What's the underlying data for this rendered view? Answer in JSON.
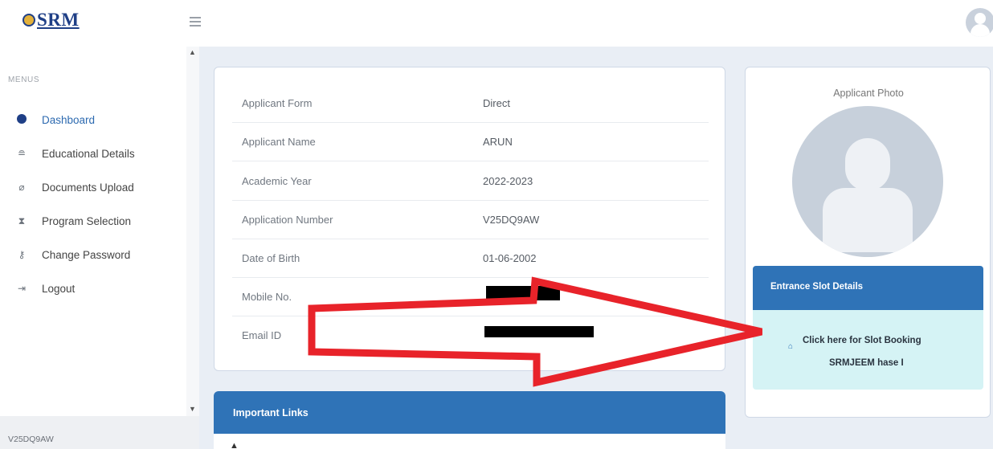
{
  "header": {
    "logo_text": "SRM",
    "menu_icon": "hamburger-icon",
    "avatar_icon": "user-avatar-icon"
  },
  "sidebar": {
    "section_label": "MENUS",
    "items": [
      {
        "label": "Dashboard",
        "icon": "dashboard-icon",
        "active": true
      },
      {
        "label": "Educational Details",
        "icon": "education-icon"
      },
      {
        "label": "Documents Upload",
        "icon": "paperclip-icon"
      },
      {
        "label": "Program Selection",
        "icon": "hourglass-icon"
      },
      {
        "label": "Change Password",
        "icon": "key-icon"
      },
      {
        "label": "Logout",
        "icon": "logout-icon"
      }
    ],
    "footer_text": "V25DQ9AW"
  },
  "applicant": {
    "rows": [
      {
        "label": "Applicant Form",
        "value": "Direct"
      },
      {
        "label": "Applicant Name",
        "value": "ARUN"
      },
      {
        "label": "Academic Year",
        "value": "2022-2023"
      },
      {
        "label": "Application Number",
        "value": "V25DQ9AW"
      },
      {
        "label": "Date of Birth",
        "value": "01-06-2002"
      },
      {
        "label": "Mobile No.",
        "value": ""
      },
      {
        "label": "Email ID",
        "value": ""
      }
    ]
  },
  "important_links": {
    "title": "Important Links"
  },
  "photo_card": {
    "title": "Applicant Photo"
  },
  "slot": {
    "title": "Entrance Slot Details",
    "line1": "Click here for Slot Booking",
    "line2": "SRMJEEM  hase I"
  },
  "colors": {
    "primary": "#2f73b7",
    "brand": "#1f3f86",
    "slot_bg": "#d5f3f5",
    "annotation_arrow": "#e8232a"
  }
}
